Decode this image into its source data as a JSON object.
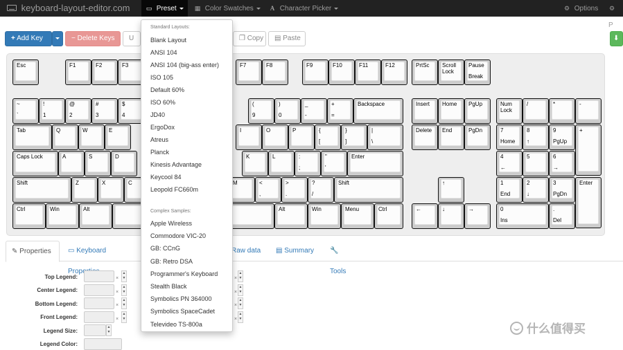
{
  "navbar": {
    "brand": "keyboard-layout-editor.com",
    "preset": "Preset",
    "color_swatches": "Color Swatches",
    "character_picker": "Character Picker",
    "options": "Options",
    "partial": "P"
  },
  "toolbar": {
    "add_key": "Add Key",
    "delete_keys": "Delete Keys",
    "undo_partial": "U",
    "copy": "Copy",
    "paste": "Paste"
  },
  "keys": [
    {
      "t": "Esc",
      "b": ""
    },
    {
      "t": "F1",
      "b": ""
    },
    {
      "t": "F2",
      "b": ""
    },
    {
      "t": "F3",
      "b": ""
    },
    {
      "t": "F7",
      "b": ""
    },
    {
      "t": "F8",
      "b": ""
    },
    {
      "t": "F9",
      "b": ""
    },
    {
      "t": "F10",
      "b": ""
    },
    {
      "t": "F11",
      "b": ""
    },
    {
      "t": "F12",
      "b": ""
    },
    {
      "t": "PrtSc",
      "b": ""
    },
    {
      "t": "Scroll\nLock",
      "b": ""
    },
    {
      "t": "Pause",
      "b": "Break"
    },
    {
      "t": "~",
      "b": "`"
    },
    {
      "t": "!",
      "b": "1"
    },
    {
      "t": "@",
      "b": "2"
    },
    {
      "t": "#",
      "b": "3"
    },
    {
      "t": "$",
      "b": "4"
    },
    {
      "t": "(",
      "b": "9"
    },
    {
      "t": ")",
      "b": "0"
    },
    {
      "t": "_",
      "b": "-"
    },
    {
      "t": "+",
      "b": "="
    },
    {
      "t": "Backspace",
      "b": ""
    },
    {
      "t": "Insert",
      "b": ""
    },
    {
      "t": "Home",
      "b": ""
    },
    {
      "t": "PgUp",
      "b": ""
    },
    {
      "t": "Num\nLock",
      "b": ""
    },
    {
      "t": "/",
      "b": ""
    },
    {
      "t": "*",
      "b": ""
    },
    {
      "t": "-",
      "b": ""
    },
    {
      "t": "Tab",
      "b": ""
    },
    {
      "t": "Q",
      "b": ""
    },
    {
      "t": "W",
      "b": ""
    },
    {
      "t": "E",
      "b": ""
    },
    {
      "t": "I",
      "b": ""
    },
    {
      "t": "O",
      "b": ""
    },
    {
      "t": "P",
      "b": ""
    },
    {
      "t": "{",
      "b": "["
    },
    {
      "t": "}",
      "b": "]"
    },
    {
      "t": "|",
      "b": "\\"
    },
    {
      "t": "Delete",
      "b": ""
    },
    {
      "t": "End",
      "b": ""
    },
    {
      "t": "PgDn",
      "b": ""
    },
    {
      "t": "7",
      "b": "Home"
    },
    {
      "t": "8",
      "b": "↑"
    },
    {
      "t": "9",
      "b": "PgUp"
    },
    {
      "t": "+",
      "b": ""
    },
    {
      "t": "Caps Lock",
      "b": ""
    },
    {
      "t": "A",
      "b": ""
    },
    {
      "t": "S",
      "b": ""
    },
    {
      "t": "D",
      "b": ""
    },
    {
      "t": "K",
      "b": ""
    },
    {
      "t": "L",
      "b": ""
    },
    {
      "t": ":",
      "b": ";"
    },
    {
      "t": "\"",
      "b": "'"
    },
    {
      "t": "Enter",
      "b": ""
    },
    {
      "t": "4",
      "b": "←"
    },
    {
      "t": "5",
      "b": ""
    },
    {
      "t": "6",
      "b": "→"
    },
    {
      "t": "Shift",
      "b": ""
    },
    {
      "t": "Z",
      "b": ""
    },
    {
      "t": "X",
      "b": ""
    },
    {
      "t": "C",
      "b": ""
    },
    {
      "t": "M",
      "b": ""
    },
    {
      "t": "<",
      "b": ","
    },
    {
      "t": ">",
      "b": "."
    },
    {
      "t": "?",
      "b": "/"
    },
    {
      "t": "Shift",
      "b": ""
    },
    {
      "t": "↑",
      "b": ""
    },
    {
      "t": "1",
      "b": "End"
    },
    {
      "t": "2",
      "b": "↓"
    },
    {
      "t": "3",
      "b": "PgDn"
    },
    {
      "t": "Enter",
      "b": ""
    },
    {
      "t": "Ctrl",
      "b": ""
    },
    {
      "t": "Win",
      "b": ""
    },
    {
      "t": "Alt",
      "b": ""
    },
    {
      "t": "",
      "b": ""
    },
    {
      "t": "Alt",
      "b": ""
    },
    {
      "t": "Win",
      "b": ""
    },
    {
      "t": "Menu",
      "b": ""
    },
    {
      "t": "Ctrl",
      "b": ""
    },
    {
      "t": "←",
      "b": ""
    },
    {
      "t": "↓",
      "b": ""
    },
    {
      "t": "→",
      "b": ""
    },
    {
      "t": "0",
      "b": "Ins"
    },
    {
      "t": ".",
      "b": "Del"
    }
  ],
  "tabs": {
    "properties": "Properties",
    "keyboard_properties": "Keyboard Properties",
    "raw_data": "Raw data",
    "summary": "Summary",
    "tools": "Tools"
  },
  "properties": {
    "top_legend": "Top Legend:",
    "center_legend": "Center Legend:",
    "bottom_legend": "Bottom Legend:",
    "front_legend": "Front Legend:",
    "legend_size": "Legend Size:",
    "legend_color": "Legend Color:"
  },
  "preset_menu": {
    "standard_header": "Standard Layouts:",
    "standard": [
      "Blank Layout",
      "ANSI 104",
      "ANSI 104 (big-ass enter)",
      "ISO 105",
      "Default 60%",
      "ISO 60%",
      "JD40",
      "ErgoDox",
      "Atreus",
      "Planck",
      "Kinesis Advantage",
      "Keycool 84",
      "Leopold FC660m"
    ],
    "complex_header": "Complex Samples:",
    "complex": [
      "Apple Wireless",
      "Commodore VIC-20",
      "GB: CCnG",
      "GB: Retro DSA",
      "Programmer's Keyboard",
      "Stealth Black",
      "Symbolics PN 364000",
      "Symbolics SpaceCadet",
      "Televideo TS-800a"
    ]
  },
  "watermark": "什么值得买",
  "colors": {
    "navbar_bg": "#222222",
    "primary": "#337ab7",
    "danger": "#d9534f",
    "success": "#5cb85c",
    "keycap_border": "#111111"
  },
  "icons": [
    "keyboard-icon",
    "gear-icon",
    "plus-icon",
    "trash-icon",
    "copy-icon",
    "paste-icon",
    "swatch-icon",
    "font-icon",
    "wrench-icon",
    "download-icon"
  ]
}
